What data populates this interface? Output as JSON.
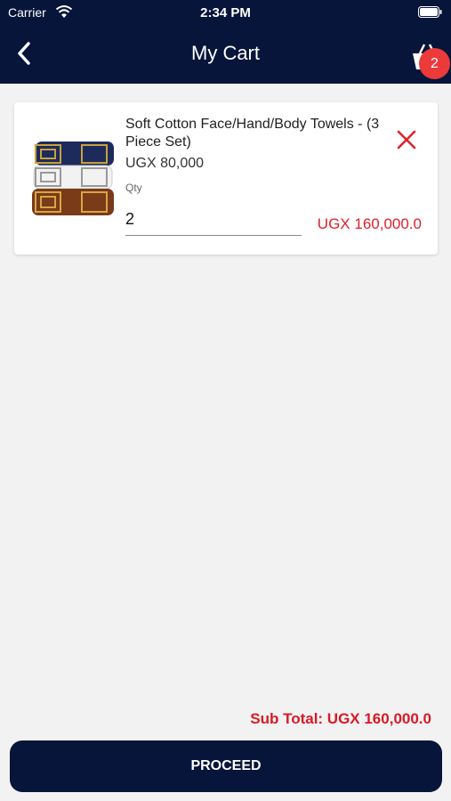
{
  "status_bar": {
    "carrier": "Carrier",
    "time": "2:34 PM"
  },
  "header": {
    "title": "My Cart",
    "cart_badge": "2",
    "back_icon": "chevron-left-icon",
    "cart_icon": "basket-icon"
  },
  "cart": {
    "items": [
      {
        "name": "Soft Cotton Face/Hand/Body Towels - (3 Piece Set)",
        "unit_price": "UGX 80,000",
        "qty_label": "Qty",
        "qty": "2",
        "line_total": "UGX 160,000.0",
        "remove_icon": "close-icon"
      }
    ]
  },
  "footer": {
    "subtotal": "Sub Total: UGX 160,000.0",
    "proceed_label": "PROCEED"
  },
  "colors": {
    "primary": "#07153a",
    "accent_red": "#e0202c",
    "badge": "#ec3a3a",
    "background": "#f3f2f2"
  }
}
